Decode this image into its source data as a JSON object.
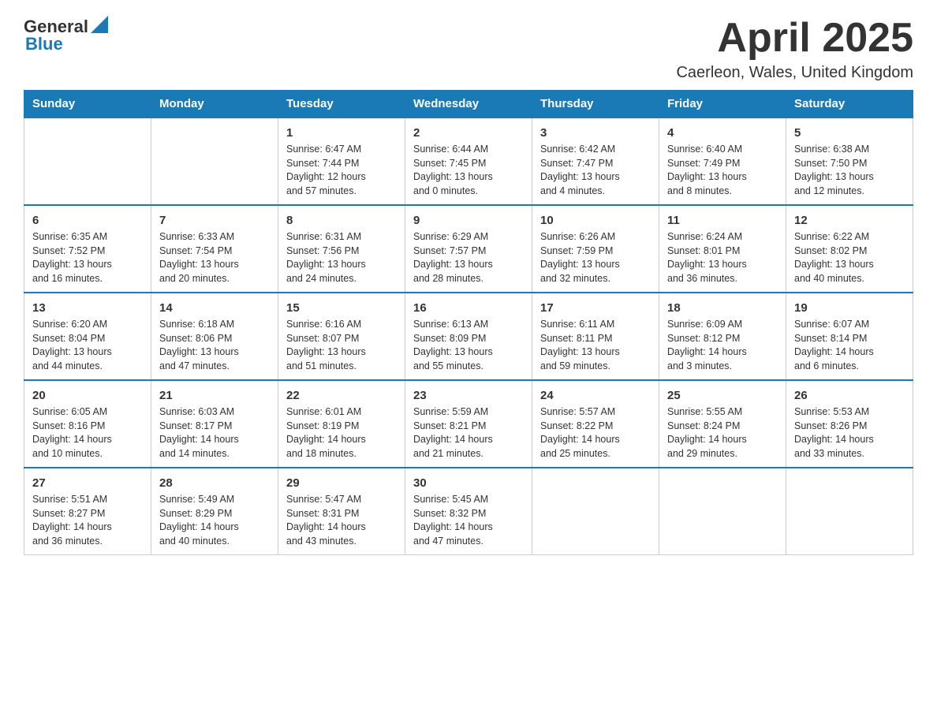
{
  "logo": {
    "text_general": "General",
    "text_blue": "Blue"
  },
  "title": "April 2025",
  "location": "Caerleon, Wales, United Kingdom",
  "days_of_week": [
    "Sunday",
    "Monday",
    "Tuesday",
    "Wednesday",
    "Thursday",
    "Friday",
    "Saturday"
  ],
  "weeks": [
    [
      {
        "day": "",
        "info": ""
      },
      {
        "day": "",
        "info": ""
      },
      {
        "day": "1",
        "info": "Sunrise: 6:47 AM\nSunset: 7:44 PM\nDaylight: 12 hours\nand 57 minutes."
      },
      {
        "day": "2",
        "info": "Sunrise: 6:44 AM\nSunset: 7:45 PM\nDaylight: 13 hours\nand 0 minutes."
      },
      {
        "day": "3",
        "info": "Sunrise: 6:42 AM\nSunset: 7:47 PM\nDaylight: 13 hours\nand 4 minutes."
      },
      {
        "day": "4",
        "info": "Sunrise: 6:40 AM\nSunset: 7:49 PM\nDaylight: 13 hours\nand 8 minutes."
      },
      {
        "day": "5",
        "info": "Sunrise: 6:38 AM\nSunset: 7:50 PM\nDaylight: 13 hours\nand 12 minutes."
      }
    ],
    [
      {
        "day": "6",
        "info": "Sunrise: 6:35 AM\nSunset: 7:52 PM\nDaylight: 13 hours\nand 16 minutes."
      },
      {
        "day": "7",
        "info": "Sunrise: 6:33 AM\nSunset: 7:54 PM\nDaylight: 13 hours\nand 20 minutes."
      },
      {
        "day": "8",
        "info": "Sunrise: 6:31 AM\nSunset: 7:56 PM\nDaylight: 13 hours\nand 24 minutes."
      },
      {
        "day": "9",
        "info": "Sunrise: 6:29 AM\nSunset: 7:57 PM\nDaylight: 13 hours\nand 28 minutes."
      },
      {
        "day": "10",
        "info": "Sunrise: 6:26 AM\nSunset: 7:59 PM\nDaylight: 13 hours\nand 32 minutes."
      },
      {
        "day": "11",
        "info": "Sunrise: 6:24 AM\nSunset: 8:01 PM\nDaylight: 13 hours\nand 36 minutes."
      },
      {
        "day": "12",
        "info": "Sunrise: 6:22 AM\nSunset: 8:02 PM\nDaylight: 13 hours\nand 40 minutes."
      }
    ],
    [
      {
        "day": "13",
        "info": "Sunrise: 6:20 AM\nSunset: 8:04 PM\nDaylight: 13 hours\nand 44 minutes."
      },
      {
        "day": "14",
        "info": "Sunrise: 6:18 AM\nSunset: 8:06 PM\nDaylight: 13 hours\nand 47 minutes."
      },
      {
        "day": "15",
        "info": "Sunrise: 6:16 AM\nSunset: 8:07 PM\nDaylight: 13 hours\nand 51 minutes."
      },
      {
        "day": "16",
        "info": "Sunrise: 6:13 AM\nSunset: 8:09 PM\nDaylight: 13 hours\nand 55 minutes."
      },
      {
        "day": "17",
        "info": "Sunrise: 6:11 AM\nSunset: 8:11 PM\nDaylight: 13 hours\nand 59 minutes."
      },
      {
        "day": "18",
        "info": "Sunrise: 6:09 AM\nSunset: 8:12 PM\nDaylight: 14 hours\nand 3 minutes."
      },
      {
        "day": "19",
        "info": "Sunrise: 6:07 AM\nSunset: 8:14 PM\nDaylight: 14 hours\nand 6 minutes."
      }
    ],
    [
      {
        "day": "20",
        "info": "Sunrise: 6:05 AM\nSunset: 8:16 PM\nDaylight: 14 hours\nand 10 minutes."
      },
      {
        "day": "21",
        "info": "Sunrise: 6:03 AM\nSunset: 8:17 PM\nDaylight: 14 hours\nand 14 minutes."
      },
      {
        "day": "22",
        "info": "Sunrise: 6:01 AM\nSunset: 8:19 PM\nDaylight: 14 hours\nand 18 minutes."
      },
      {
        "day": "23",
        "info": "Sunrise: 5:59 AM\nSunset: 8:21 PM\nDaylight: 14 hours\nand 21 minutes."
      },
      {
        "day": "24",
        "info": "Sunrise: 5:57 AM\nSunset: 8:22 PM\nDaylight: 14 hours\nand 25 minutes."
      },
      {
        "day": "25",
        "info": "Sunrise: 5:55 AM\nSunset: 8:24 PM\nDaylight: 14 hours\nand 29 minutes."
      },
      {
        "day": "26",
        "info": "Sunrise: 5:53 AM\nSunset: 8:26 PM\nDaylight: 14 hours\nand 33 minutes."
      }
    ],
    [
      {
        "day": "27",
        "info": "Sunrise: 5:51 AM\nSunset: 8:27 PM\nDaylight: 14 hours\nand 36 minutes."
      },
      {
        "day": "28",
        "info": "Sunrise: 5:49 AM\nSunset: 8:29 PM\nDaylight: 14 hours\nand 40 minutes."
      },
      {
        "day": "29",
        "info": "Sunrise: 5:47 AM\nSunset: 8:31 PM\nDaylight: 14 hours\nand 43 minutes."
      },
      {
        "day": "30",
        "info": "Sunrise: 5:45 AM\nSunset: 8:32 PM\nDaylight: 14 hours\nand 47 minutes."
      },
      {
        "day": "",
        "info": ""
      },
      {
        "day": "",
        "info": ""
      },
      {
        "day": "",
        "info": ""
      }
    ]
  ]
}
